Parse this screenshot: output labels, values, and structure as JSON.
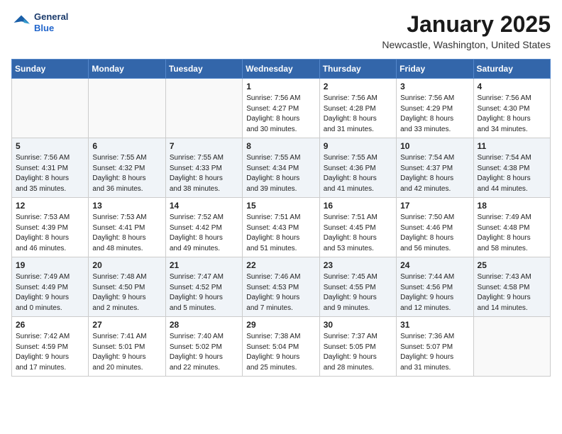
{
  "header": {
    "logo": {
      "line1": "General",
      "line2": "Blue"
    },
    "title": "January 2025",
    "location": "Newcastle, Washington, United States"
  },
  "weekdays": [
    "Sunday",
    "Monday",
    "Tuesday",
    "Wednesday",
    "Thursday",
    "Friday",
    "Saturday"
  ],
  "weeks": [
    [
      {
        "day": "",
        "content": ""
      },
      {
        "day": "",
        "content": ""
      },
      {
        "day": "",
        "content": ""
      },
      {
        "day": "1",
        "content": "Sunrise: 7:56 AM\nSunset: 4:27 PM\nDaylight: 8 hours\nand 30 minutes."
      },
      {
        "day": "2",
        "content": "Sunrise: 7:56 AM\nSunset: 4:28 PM\nDaylight: 8 hours\nand 31 minutes."
      },
      {
        "day": "3",
        "content": "Sunrise: 7:56 AM\nSunset: 4:29 PM\nDaylight: 8 hours\nand 33 minutes."
      },
      {
        "day": "4",
        "content": "Sunrise: 7:56 AM\nSunset: 4:30 PM\nDaylight: 8 hours\nand 34 minutes."
      }
    ],
    [
      {
        "day": "5",
        "content": "Sunrise: 7:56 AM\nSunset: 4:31 PM\nDaylight: 8 hours\nand 35 minutes."
      },
      {
        "day": "6",
        "content": "Sunrise: 7:55 AM\nSunset: 4:32 PM\nDaylight: 8 hours\nand 36 minutes."
      },
      {
        "day": "7",
        "content": "Sunrise: 7:55 AM\nSunset: 4:33 PM\nDaylight: 8 hours\nand 38 minutes."
      },
      {
        "day": "8",
        "content": "Sunrise: 7:55 AM\nSunset: 4:34 PM\nDaylight: 8 hours\nand 39 minutes."
      },
      {
        "day": "9",
        "content": "Sunrise: 7:55 AM\nSunset: 4:36 PM\nDaylight: 8 hours\nand 41 minutes."
      },
      {
        "day": "10",
        "content": "Sunrise: 7:54 AM\nSunset: 4:37 PM\nDaylight: 8 hours\nand 42 minutes."
      },
      {
        "day": "11",
        "content": "Sunrise: 7:54 AM\nSunset: 4:38 PM\nDaylight: 8 hours\nand 44 minutes."
      }
    ],
    [
      {
        "day": "12",
        "content": "Sunrise: 7:53 AM\nSunset: 4:39 PM\nDaylight: 8 hours\nand 46 minutes."
      },
      {
        "day": "13",
        "content": "Sunrise: 7:53 AM\nSunset: 4:41 PM\nDaylight: 8 hours\nand 48 minutes."
      },
      {
        "day": "14",
        "content": "Sunrise: 7:52 AM\nSunset: 4:42 PM\nDaylight: 8 hours\nand 49 minutes."
      },
      {
        "day": "15",
        "content": "Sunrise: 7:51 AM\nSunset: 4:43 PM\nDaylight: 8 hours\nand 51 minutes."
      },
      {
        "day": "16",
        "content": "Sunrise: 7:51 AM\nSunset: 4:45 PM\nDaylight: 8 hours\nand 53 minutes."
      },
      {
        "day": "17",
        "content": "Sunrise: 7:50 AM\nSunset: 4:46 PM\nDaylight: 8 hours\nand 56 minutes."
      },
      {
        "day": "18",
        "content": "Sunrise: 7:49 AM\nSunset: 4:48 PM\nDaylight: 8 hours\nand 58 minutes."
      }
    ],
    [
      {
        "day": "19",
        "content": "Sunrise: 7:49 AM\nSunset: 4:49 PM\nDaylight: 9 hours\nand 0 minutes."
      },
      {
        "day": "20",
        "content": "Sunrise: 7:48 AM\nSunset: 4:50 PM\nDaylight: 9 hours\nand 2 minutes."
      },
      {
        "day": "21",
        "content": "Sunrise: 7:47 AM\nSunset: 4:52 PM\nDaylight: 9 hours\nand 5 minutes."
      },
      {
        "day": "22",
        "content": "Sunrise: 7:46 AM\nSunset: 4:53 PM\nDaylight: 9 hours\nand 7 minutes."
      },
      {
        "day": "23",
        "content": "Sunrise: 7:45 AM\nSunset: 4:55 PM\nDaylight: 9 hours\nand 9 minutes."
      },
      {
        "day": "24",
        "content": "Sunrise: 7:44 AM\nSunset: 4:56 PM\nDaylight: 9 hours\nand 12 minutes."
      },
      {
        "day": "25",
        "content": "Sunrise: 7:43 AM\nSunset: 4:58 PM\nDaylight: 9 hours\nand 14 minutes."
      }
    ],
    [
      {
        "day": "26",
        "content": "Sunrise: 7:42 AM\nSunset: 4:59 PM\nDaylight: 9 hours\nand 17 minutes."
      },
      {
        "day": "27",
        "content": "Sunrise: 7:41 AM\nSunset: 5:01 PM\nDaylight: 9 hours\nand 20 minutes."
      },
      {
        "day": "28",
        "content": "Sunrise: 7:40 AM\nSunset: 5:02 PM\nDaylight: 9 hours\nand 22 minutes."
      },
      {
        "day": "29",
        "content": "Sunrise: 7:38 AM\nSunset: 5:04 PM\nDaylight: 9 hours\nand 25 minutes."
      },
      {
        "day": "30",
        "content": "Sunrise: 7:37 AM\nSunset: 5:05 PM\nDaylight: 9 hours\nand 28 minutes."
      },
      {
        "day": "31",
        "content": "Sunrise: 7:36 AM\nSunset: 5:07 PM\nDaylight: 9 hours\nand 31 minutes."
      },
      {
        "day": "",
        "content": ""
      }
    ]
  ]
}
